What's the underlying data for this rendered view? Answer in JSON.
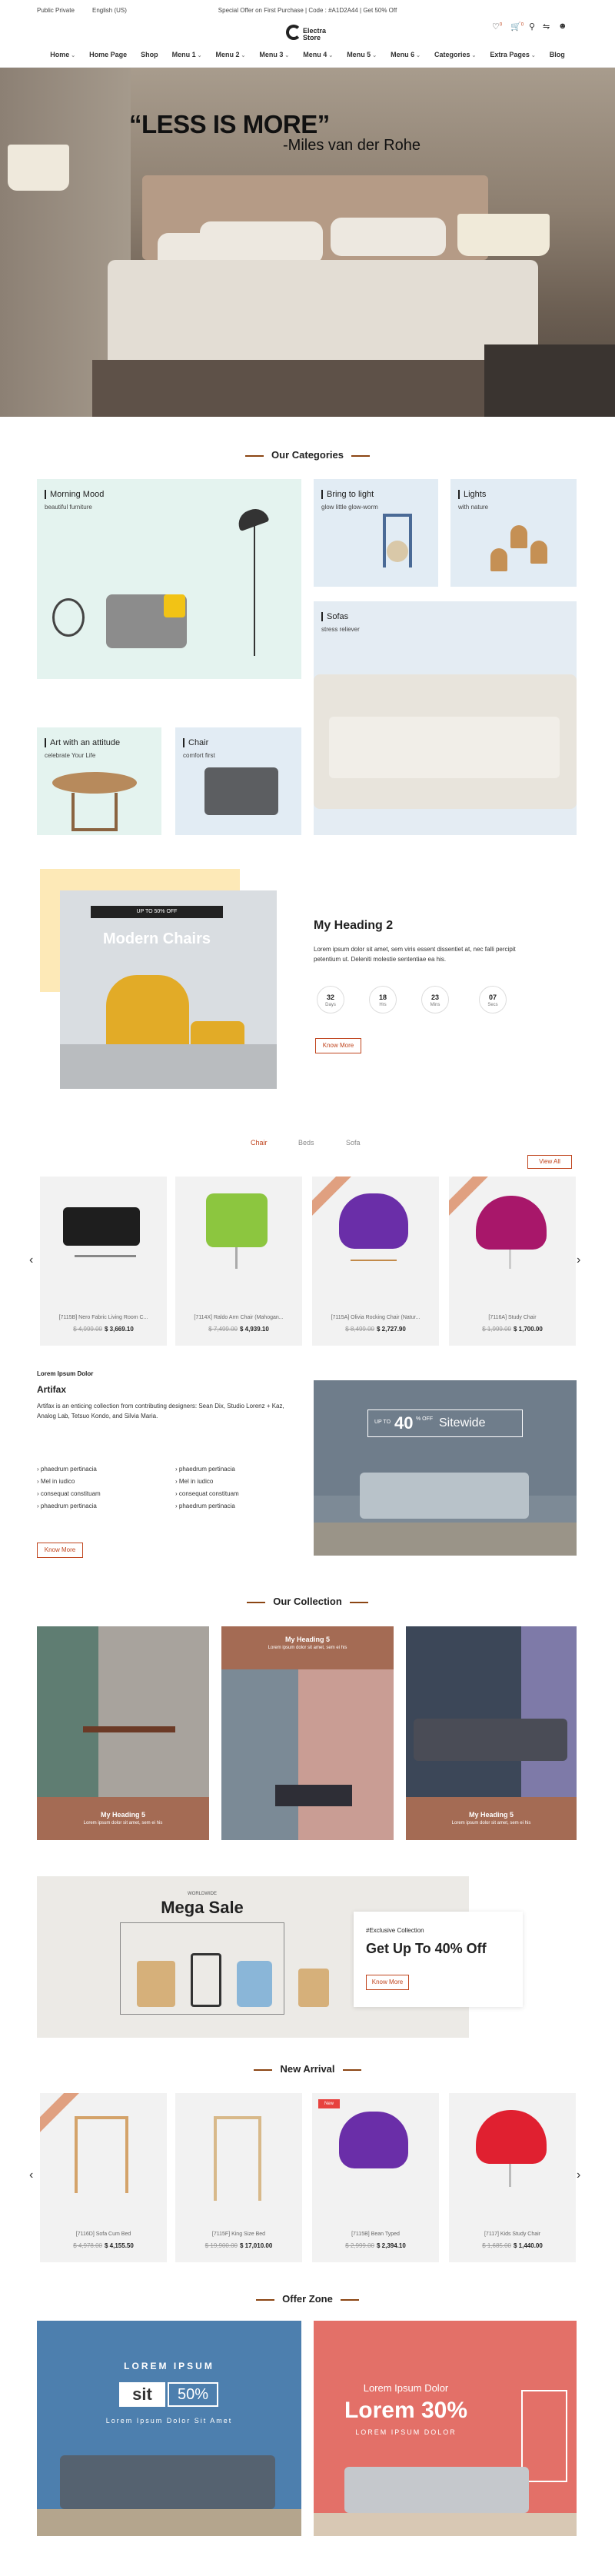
{
  "topbar": {
    "left1": "Public Private",
    "left2": "English (US)",
    "notice": "Special Offer on First Purchase  |  Code : #A1D2A44  |  Get 50% Off"
  },
  "header": {
    "logo": "Electra Store",
    "cart_count": "0",
    "wish_count": "0",
    "menu": [
      "Home",
      "Home Page",
      "Shop",
      "Menu 1",
      "Menu 2",
      "Menu 3",
      "Menu 4",
      "Menu 5",
      "Menu 6",
      "Categories",
      "Extra Pages",
      "Blog"
    ]
  },
  "hero": {
    "quote": "“LESS IS MORE”",
    "author": "-Miles van der Rohe"
  },
  "categories": {
    "title": "Our Categories",
    "items": [
      {
        "title": "Morning Mood",
        "sub": "beautiful furniture"
      },
      {
        "title": "Bring to light",
        "sub": "glow little glow-worm"
      },
      {
        "title": "Lights",
        "sub": "with nature"
      },
      {
        "title": "Sofas",
        "sub": "stress reliever"
      },
      {
        "title": "Art with an attitude",
        "sub": "celebrate Your Life"
      },
      {
        "title": "Chair",
        "sub": "comfort first"
      }
    ]
  },
  "promo": {
    "badge": "UP TO 50% OFF",
    "label": "Modern Chairs",
    "heading": "My Heading 2",
    "text": "Lorem ipsum dolor sit amet, sem viris essent dissentiet at, nec falli percipit petentium ut. Deleniti molestie sententiae ea his.",
    "countdown": [
      {
        "num": "32",
        "unit": "Days"
      },
      {
        "num": "18",
        "unit": "Hrs"
      },
      {
        "num": "23",
        "unit": "Mins"
      },
      {
        "num": "07",
        "unit": "Secs"
      }
    ],
    "button": "Know More"
  },
  "product_tabs": {
    "tabs": [
      "Chair",
      "Beds",
      "Sofa"
    ],
    "view_all": "View All",
    "items": [
      {
        "name": "[7115B] Nero Fabric Living Room C...",
        "old": "$ 4,999.00",
        "price": "$ 3,669.10"
      },
      {
        "name": "[7114X] Raldo Arm Chair (Mahogan...",
        "old": "$ 7,499.00",
        "price": "$ 4,939.10"
      },
      {
        "name": "[7115A] Olivia Rocking Chair (Natur...",
        "old": "$ 8,499.00",
        "price": "$ 2,727.90"
      },
      {
        "name": "[7116A] Study Chair",
        "old": "$ 1,999.00",
        "price": "$ 1,700.00"
      }
    ]
  },
  "artifax": {
    "kicker": "Lorem Ipsum Dolor",
    "title": "Artifax",
    "text": "Artifax is an enticing collection from contributing designers: Sean Dix, Studio Lorenz + Kaz, Analog Lab, Tetsuo Kondo, and Silvia Maria.",
    "bullets_left": [
      "phaedrum pertinacia",
      "Mel in iudico",
      "consequat constituam",
      "phaedrum pertinacia"
    ],
    "bullets_right": [
      "phaedrum pertinacia",
      "Mel in iudico",
      "consequat constituam",
      "phaedrum pertinacia"
    ],
    "button": "Know More",
    "banner_up": "UP TO",
    "banner_pct": "40",
    "banner_off": "% OFF",
    "banner_word": "Sitewide"
  },
  "collection": {
    "title": "Our Collection",
    "items": [
      {
        "heading": "My Heading 5",
        "text": "Lorem ipsum dolor sit amet, sem ei his"
      },
      {
        "heading": "My Heading 5",
        "text": "Lorem ipsum dolor sit amet, sem ei his"
      },
      {
        "heading": "My Heading 5",
        "text": "Lorem ipsum dolor sit amet, sem ei his"
      }
    ]
  },
  "mega": {
    "small": "WORLDWIDE",
    "title": "Mega Sale",
    "kicker": "#Exclusive Collection",
    "heading": "Get Up To 40% Off",
    "button": "Know More"
  },
  "arrivals": {
    "title": "New Arrival",
    "items": [
      {
        "name": "[7116D] Sofa Cum Bed",
        "old": "$ 4,978.00",
        "price": "$ 4,155.50"
      },
      {
        "name": "[7115F] King Size Bed",
        "old": "$ 19,900.00",
        "price": "$ 17,010.00"
      },
      {
        "name": "[7115B] Bean Typed",
        "old": "$ 2,999.00",
        "price": "$ 2,394.10"
      },
      {
        "name": "[7117] Kids Study Chair",
        "old": "$ 1,685.00",
        "price": "$ 1,440.00"
      }
    ]
  },
  "offer": {
    "title": "Offer Zone",
    "left_top": "LOREM IPSUM",
    "left_box": "sit",
    "left_pct": "50%",
    "left_sub": "Lorem Ipsum Dolor Sit Amet",
    "right_top": "Lorem Ipsum Dolor",
    "right_big": "Lorem 30%",
    "right_sub": "LOREM IPSUM DOLOR"
  },
  "colors": {
    "accent": "#c0451e",
    "brown": "#a46b54",
    "mint": "#e4f3ef",
    "pale_blue": "#e2ecf4"
  }
}
